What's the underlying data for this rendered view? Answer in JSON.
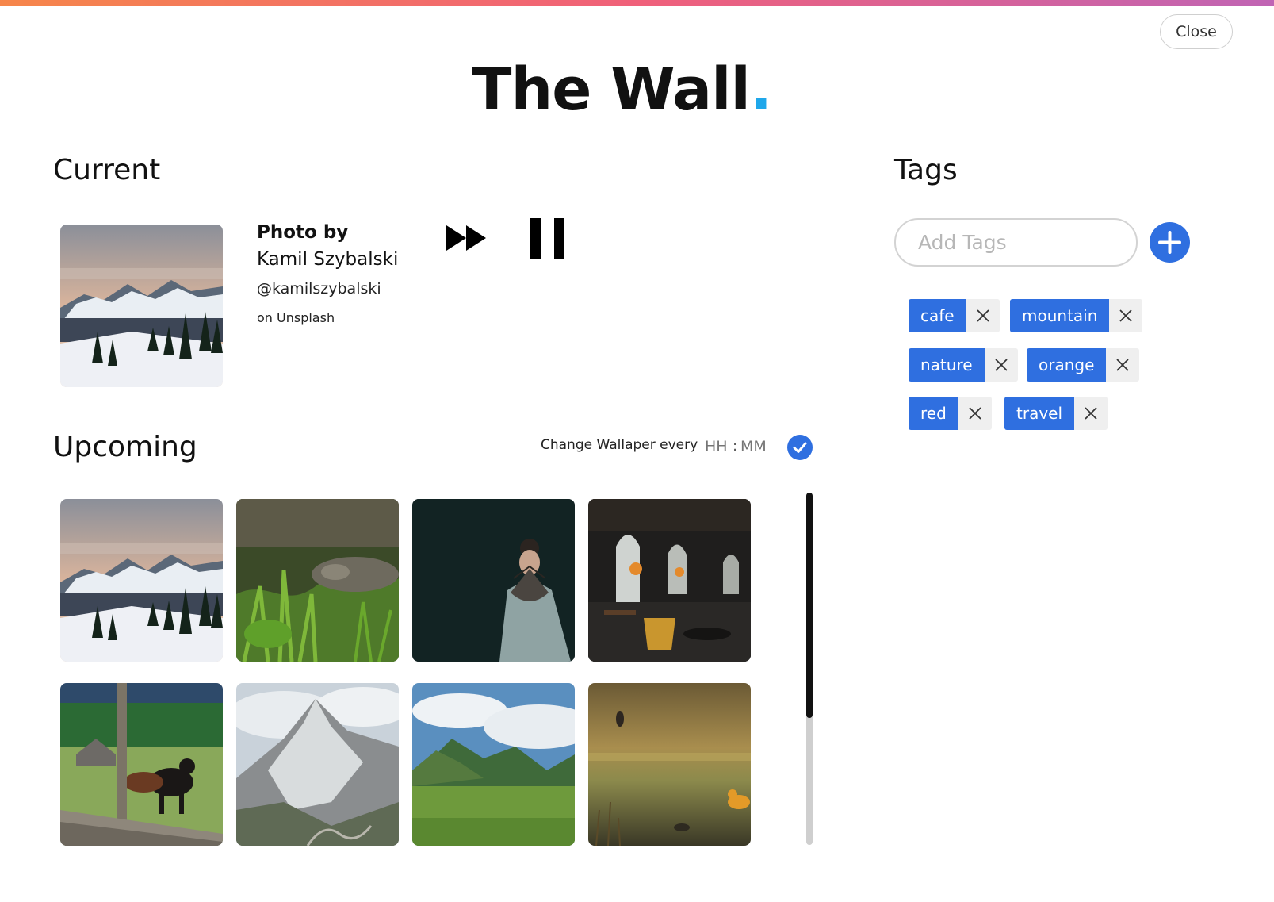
{
  "app": {
    "title_main": "The Wall",
    "title_dot": ".",
    "close_label": "Close",
    "colors": {
      "accent": "#2f6fe0",
      "title_dot": "#1fa7ea",
      "gradient_start": "#f6864a",
      "gradient_mid": "#f0607a",
      "gradient_end": "#c064b4"
    }
  },
  "current": {
    "heading": "Current",
    "thumbnail_icon": "snowy-mountain-photo",
    "photo_by_label": "Photo by",
    "photographer": "Kamil Szybalski",
    "handle": "@kamilszybalski",
    "source": "on Unsplash",
    "controls": {
      "skip_icon": "fast-forward-icon",
      "pause_icon": "pause-icon"
    }
  },
  "upcoming": {
    "heading": "Upcoming",
    "interval_label": "Change Wallaper every",
    "hours_placeholder": "HH",
    "separator": ":",
    "minutes_placeholder": "MM",
    "confirm_icon": "check-circle-icon",
    "photos": [
      "snowy-mountain-photo",
      "crocodile-in-grass-photo",
      "woman-with-fan-photo",
      "cafe-interior-photo",
      "cow-in-meadow-photo",
      "cloudy-peak-photo",
      "green-valley-photo",
      "ducks-on-pond-photo"
    ]
  },
  "tags": {
    "heading": "Tags",
    "input_placeholder": "Add Tags",
    "add_icon": "plus-icon",
    "remove_icon": "close-icon",
    "items": [
      "cafe",
      "mountain",
      "nature",
      "orange",
      "red",
      "travel"
    ]
  }
}
